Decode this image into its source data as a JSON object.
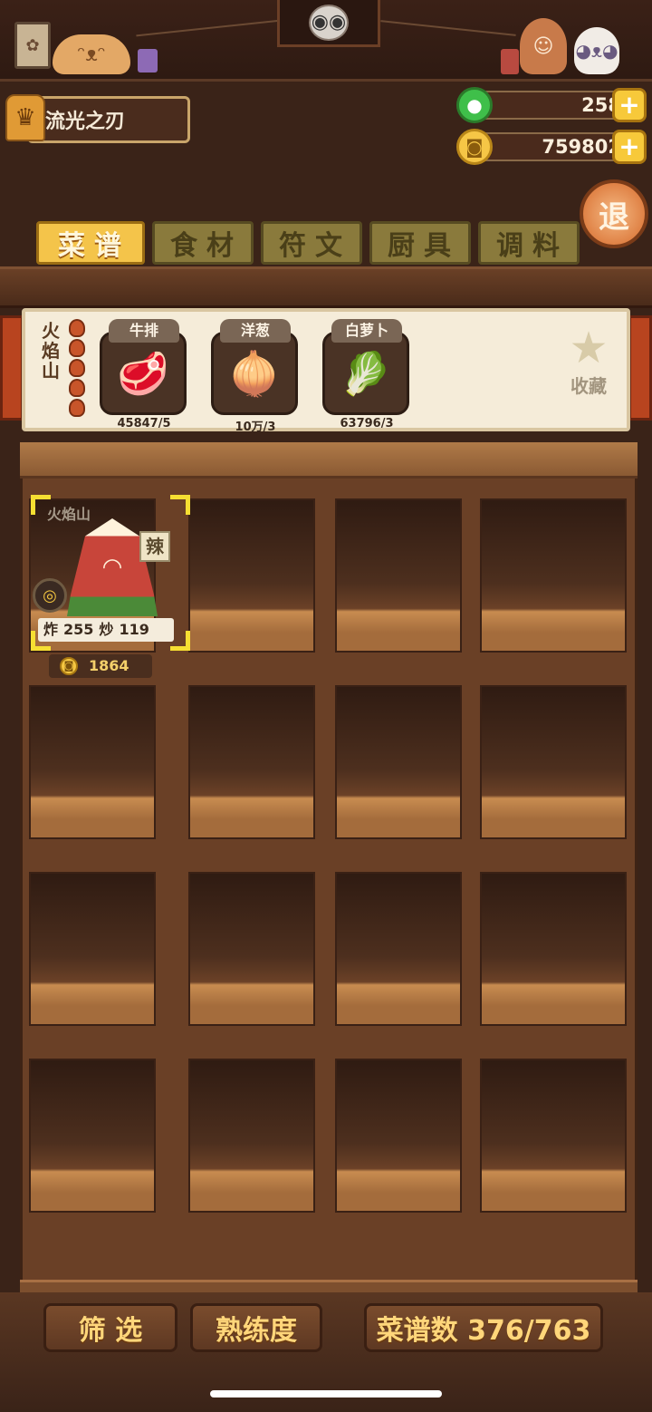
{
  "header": {
    "player_name": "流光之刃",
    "currencies": [
      {
        "name": "jade",
        "value": "258",
        "icon": "jade-coin-icon"
      },
      {
        "name": "gold",
        "value": "759802",
        "icon": "gold-coin-icon"
      }
    ],
    "plus_label": "+",
    "exit_label": "退"
  },
  "tabs": [
    {
      "label": "菜谱",
      "active": true
    },
    {
      "label": "食材",
      "active": false
    },
    {
      "label": "符文",
      "active": false
    },
    {
      "label": "厨具",
      "active": false
    },
    {
      "label": "调料",
      "active": false
    }
  ],
  "recipe_detail": {
    "name": "火焰山",
    "flame_level": 5,
    "ingredients": [
      {
        "name": "牛排",
        "count": "45847/5",
        "icon": "steak-icon"
      },
      {
        "name": "洋葱",
        "count": "10万/3",
        "icon": "onion-icon"
      },
      {
        "name": "白萝卜",
        "count": "63796/3",
        "icon": "radish-icon"
      }
    ],
    "favorite_label": "收藏"
  },
  "dishes": [
    {
      "name": "火焰山",
      "spice_tag": "辣",
      "methods": [
        {
          "label": "炸",
          "value": "255"
        },
        {
          "label": "炒",
          "value": "119"
        }
      ],
      "price": "1864"
    }
  ],
  "footer": {
    "filter_label": "筛 选",
    "proficiency_label": "熟练度",
    "recipe_count_label": "菜谱数 376/763"
  },
  "colors": {
    "accent": "#f4c44a",
    "selection": "#f6df32",
    "wood": "#6a4026"
  }
}
